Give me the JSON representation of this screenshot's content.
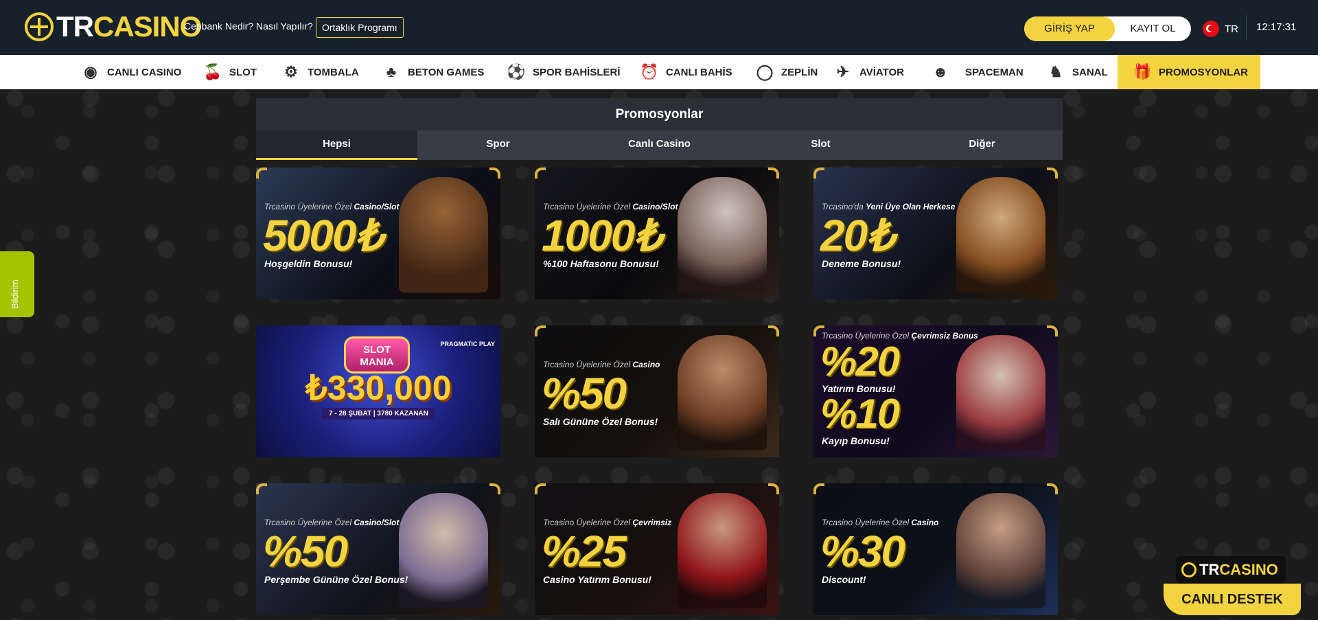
{
  "header": {
    "logo": {
      "part1": "TR",
      "part2": "CASINO"
    },
    "link_cepbank": "Cepbank Nedir? Nasıl Yapılır?",
    "partner_button": "Ortaklık Programı",
    "login": "GİRİŞ YAP",
    "register": "KAYIT OL",
    "language": "TR",
    "time": "12:17:31"
  },
  "nav": [
    {
      "label": "CANLI CASINO",
      "icon": "casino-chip-icon"
    },
    {
      "label": "SLOT",
      "icon": "cherry-icon"
    },
    {
      "label": "TOMBALA",
      "icon": "tombala-icon"
    },
    {
      "label": "BETON GAMES",
      "icon": "cards-icon"
    },
    {
      "label": "SPOR BAHİSLERİ",
      "icon": "soccer-ball-icon"
    },
    {
      "label": "CANLI BAHİS",
      "icon": "alarm-clock-icon"
    },
    {
      "label": "ZEPLİN",
      "icon": "zeppelin-icon"
    },
    {
      "label": "AVİATOR",
      "icon": "airplane-icon"
    },
    {
      "label": "SPACEMAN",
      "icon": "astronaut-icon"
    },
    {
      "label": "SANAL",
      "icon": "virtual-horse-icon"
    },
    {
      "label": "PROMOSYONLAR",
      "icon": "gift-icon"
    }
  ],
  "promotions": {
    "title": "Promosyonlar",
    "tabs": [
      "Hepsi",
      "Spor",
      "Canlı Casino",
      "Slot",
      "Diğer"
    ],
    "cards": [
      {
        "top_prefix": "Trcasino Üyelerine Özel",
        "top_highlight": "Casino/Slot",
        "big": "5000₺",
        "sub": "Hoşgeldin Bonusu!"
      },
      {
        "top_prefix": "Trcasino Üyelerine Özel",
        "top_highlight": "Casino/Slot",
        "big": "1000₺",
        "sub": "%100 Haftasonu Bonusu!"
      },
      {
        "top_prefix": "Trcasino'da",
        "top_highlight": "Yeni Üye Olan Herkese",
        "big": "20₺",
        "sub": "Deneme Bonusu!"
      },
      {
        "slot_title_1": "SLOT",
        "slot_title_2": "MANIA",
        "amount": "₺330,000",
        "dates": "7 - 28 ŞUBAT  |  3780 KAZANAN",
        "brand": "PRAGMATIC PLAY"
      },
      {
        "top_prefix": "Trcasino Üyelerine Özel",
        "top_highlight": "Casino",
        "big": "%50",
        "sub": "Salı Gününe Özel Bonus!"
      },
      {
        "top_prefix": "Trcasino Üyelerine Özel",
        "top_highlight": "Çevrimsiz Bonus",
        "big": "%20",
        "sub": "Yatırım Bonusu!",
        "big2": "%10",
        "sub2": "Kayıp Bonusu!"
      },
      {
        "top_prefix": "Trcasino Üyelerine Özel",
        "top_highlight": "Casino/Slot",
        "big": "%50",
        "sub": "Perşembe Gününe Özel Bonus!"
      },
      {
        "top_prefix": "Trcasino Üyelerine Özel",
        "top_highlight": "Çevrimsiz",
        "big": "%25",
        "sub": "Casino Yatırım Bonusu!"
      },
      {
        "top_prefix": "Trcasino Üyelerine Özel",
        "top_highlight": "Casino",
        "big": "%30",
        "sub": "Discount!"
      }
    ]
  },
  "side_tab": "Bildirim",
  "support": {
    "logo_part1": "TR",
    "logo_part2": "CASINO",
    "button": "CANLI DESTEK"
  },
  "colors": {
    "accent": "#f3d33f",
    "header_bg": "#17212b",
    "side_tab": "#a4c400"
  }
}
